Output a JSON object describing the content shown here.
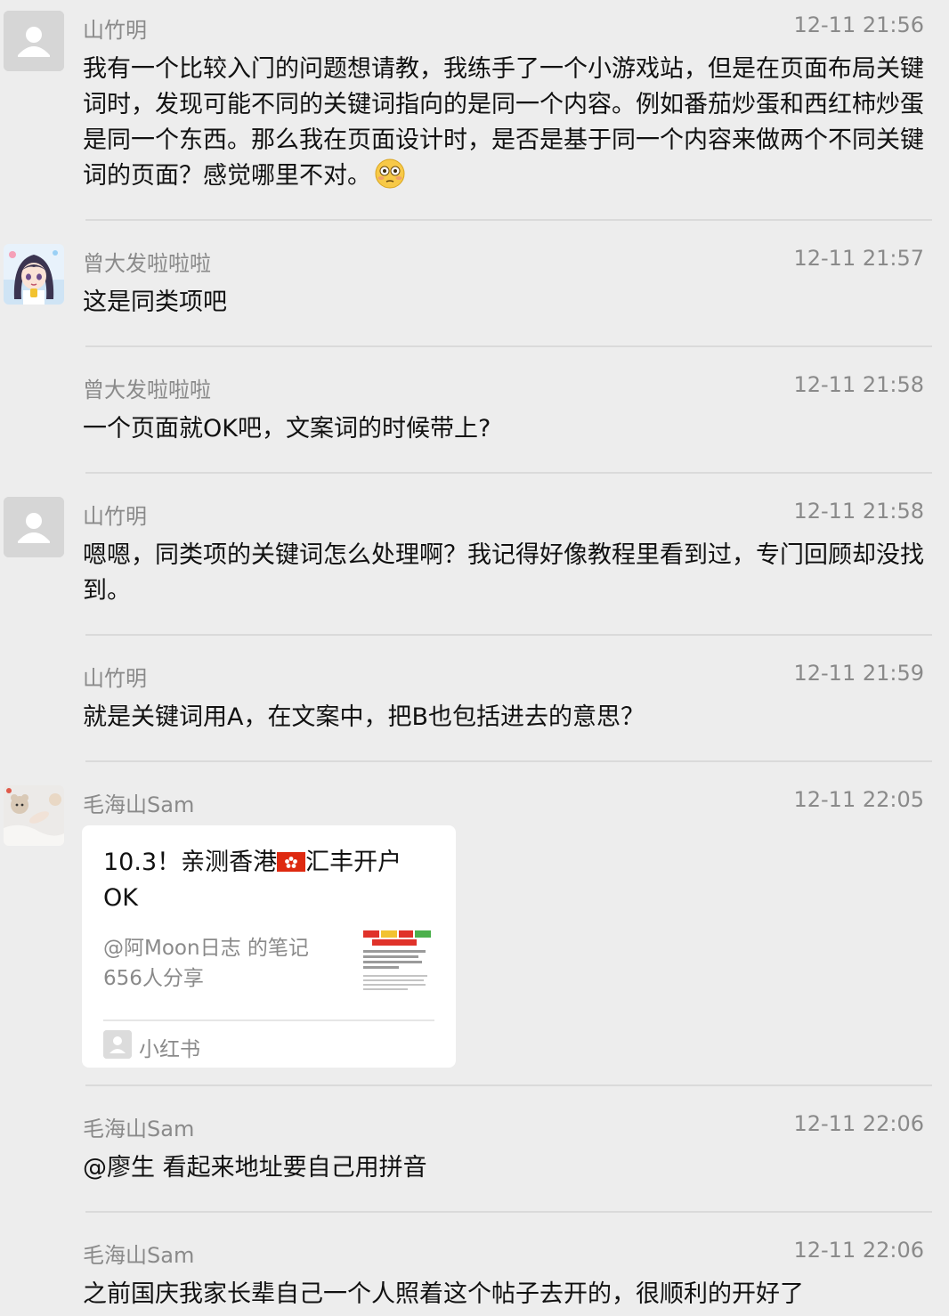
{
  "messages": [
    {
      "name": "山竹明",
      "time": "12-11 21:56",
      "text": "我有一个比较入门的问题想请教，我练手了一个小游戏站，但是在页面布局关键词时，发现可能不同的关键词指向的是同一个内容。例如番茄炒蛋和西红柿炒蛋是同一个东西。那么我在页面设计时，是否是基于同一个内容来做两个不同关键词的页面？感觉哪里不对。",
      "emoji": "flushed-face"
    },
    {
      "name": "曾大发啦啦啦",
      "time": "12-11 21:57",
      "text": "这是同类项吧"
    },
    {
      "name": "曾大发啦啦啦",
      "time": "12-11 21:58",
      "text": "一个页面就OK吧，文案词的时候带上?"
    },
    {
      "name": "山竹明",
      "time": "12-11 21:58",
      "text": "嗯嗯，同类项的关键词怎么处理啊？我记得好像教程里看到过，专门回顾却没找到。"
    },
    {
      "name": "山竹明",
      "time": "12-11 21:59",
      "text": "就是关键词用A，在文案中，把B也包括进去的意思？"
    },
    {
      "name": "毛海山Sam",
      "time": "12-11 22:05",
      "card": {
        "title_pre": "10.3！亲测香港",
        "title_flag": "hong-kong-flag",
        "title_post": "汇丰开户OK",
        "source": "@阿Moon日志 的笔记",
        "shares": "656人分享",
        "app_name": "小红书"
      }
    },
    {
      "name": "毛海山Sam",
      "time": "12-11 22:06",
      "text": "@廖生 看起来地址要自己用拼音"
    },
    {
      "name": "毛海山Sam",
      "time": "12-11 22:06",
      "text": "之前国庆我家长辈自己一个人照着这个帖子去开的，很顺利的开好了"
    }
  ],
  "colors": {
    "background": "#ededed",
    "name_text": "#8a8a8a",
    "body_text": "#111111",
    "card_background": "#ffffff",
    "divider": "#dadada"
  }
}
